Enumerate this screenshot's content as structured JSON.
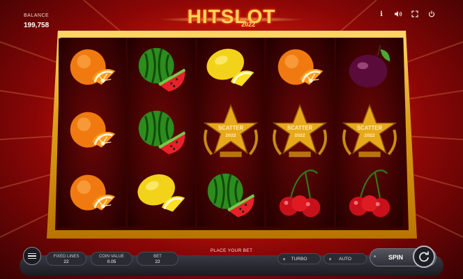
{
  "balance": {
    "label": "BALANCE",
    "value": "199,758"
  },
  "logo": {
    "text": "HITSLOT",
    "year": "2022"
  },
  "top_icons": [
    "info-icon",
    "sound-icon",
    "fullscreen-icon",
    "power-icon"
  ],
  "top_icon_glyphs": [
    "ℹ",
    "🔊",
    "⛶",
    "⏻"
  ],
  "reels": [
    [
      "orange",
      "orange",
      "orange"
    ],
    [
      "watermelon",
      "watermelon",
      "lemon"
    ],
    [
      "lemon",
      "scatter",
      "watermelon"
    ],
    [
      "orange",
      "scatter",
      "cherry"
    ],
    [
      "plum",
      "scatter",
      "cherry"
    ]
  ],
  "scatter_text": {
    "line1": "SCATTER",
    "line2": "2022"
  },
  "bottom": {
    "place_bet": "PLACE YOUR BET",
    "fixed_lines": {
      "label": "FIXED LINES",
      "value": "22"
    },
    "coin_value": {
      "label": "COIN VALUE",
      "value": "0.05"
    },
    "bet": {
      "label": "BET",
      "value": "22"
    },
    "turbo": "TURBO",
    "auto": "AUTO",
    "spin": "SPIN"
  },
  "colors": {
    "accent": "#ffd05a",
    "frame": "#e0a21a",
    "background": "#d81d0c"
  }
}
